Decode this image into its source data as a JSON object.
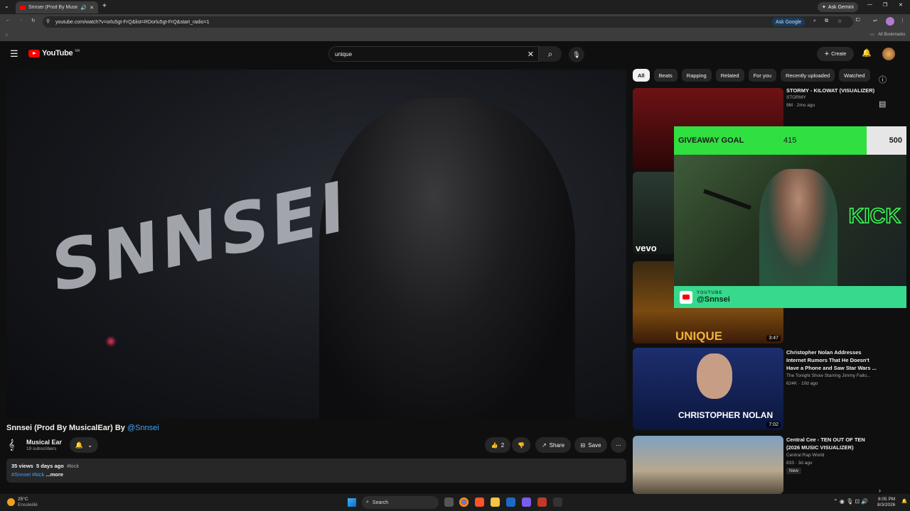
{
  "browser": {
    "tab_title": "Snnsei (Prod By MusicalEar)",
    "ask_gemini": "Ask Gemini",
    "url": "youtube.com/watch?v=orlu5gt-FrQ&list=RDorlu5gt-FrQ&start_radio=1",
    "ask_google": "Ask Google",
    "all_bookmarks": "All Bookmarks"
  },
  "header": {
    "logo_text": "YouTube",
    "country": "MA",
    "search_value": "unique",
    "create_label": "Create"
  },
  "video": {
    "overlay_text": "SNNSEI",
    "title": "Snnsei (Prod By MusicalEar) By ",
    "title_handle": "@Snnsei",
    "channel_name": "Musical Ear",
    "subscribers": "19 subscribers",
    "likes": "2",
    "share_label": "Share",
    "save_label": "Save",
    "views": "35 views",
    "posted": "5 days ago",
    "tag_kick": "#kick",
    "hashtags": "#Snnsei #kick",
    "more": "...more"
  },
  "chips": [
    "All",
    "Beats",
    "Rapping",
    "Related",
    "For you",
    "Recently uploaded",
    "Watched"
  ],
  "recommendations": [
    {
      "title": "STORMY - KILOWAT (VISUALIZER)",
      "channel": "STORMY",
      "meta": "9M · 2mo ago",
      "duration": ""
    },
    {
      "title": "",
      "channel": "",
      "meta": "",
      "duration": "",
      "badge": "vevo"
    },
    {
      "title": "",
      "channel": "",
      "meta": "",
      "duration": "3:47",
      "thumb_text": "UNIQUE"
    },
    {
      "title": "Christopher Nolan Addresses Internet Rumors That He Doesn't Have a Phone and Saw Star Wars ...",
      "channel": "The Tonight Show Starring Jimmy Fallo...",
      "meta": "624K · 10d ago",
      "duration": "7:02",
      "thumb_text": "CHRISTOPHER NOLAN"
    },
    {
      "title": "Central Cee - TEN OUT OF TEN (2026 MUSIC VISUALIZER)",
      "channel": "Central Rap World",
      "meta": "833 · 3d ago",
      "duration": "",
      "badge": "New"
    }
  ],
  "stream_overlay": {
    "goal_label": "GIVEAWAY GOAL",
    "goal_current": "415",
    "goal_target": "500",
    "goal_fraction": 0.83,
    "platform": "YOUTUBE",
    "handle": "@Snnsei",
    "sign": "KICK"
  },
  "taskbar": {
    "weather_temp": "25°C",
    "weather_desc": "Ensoleillé",
    "search_label": "Search",
    "time": "8:05 PM",
    "date": "8/3/2026"
  },
  "colors": {
    "accent": "#3ea6ff",
    "brand": "#ff0000",
    "goal": "#2fe040",
    "yt_bar": "#37d98c"
  }
}
